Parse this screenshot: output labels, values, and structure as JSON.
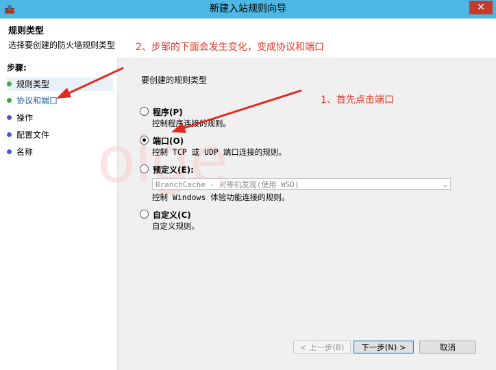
{
  "window": {
    "title": "新建入站规则向导",
    "close_label": "✕"
  },
  "header": {
    "title": "规则类型",
    "subtitle": "选择要创建的防火墙规则类型"
  },
  "annotations": {
    "top": "2、步邹的下面会发生变化，变成协议和端口",
    "right": "1、首先点击端口"
  },
  "sidebar": {
    "title": "步骤:",
    "steps": [
      {
        "label": "规则类型",
        "color": "#3fa842"
      },
      {
        "label": "协议和端口",
        "color": "#3fa842"
      },
      {
        "label": "操作",
        "color": "#4a5bc9"
      },
      {
        "label": "配置文件",
        "color": "#4a5bc9"
      },
      {
        "label": "名称",
        "color": "#4a5bc9"
      }
    ]
  },
  "main": {
    "question": "要创建的规则类型",
    "options": [
      {
        "label": "程序(P)",
        "desc": "控制程序连接的规则。",
        "selected": false
      },
      {
        "label": "端口(O)",
        "desc": "控制 TCP 或 UDP 端口连接的规则。",
        "selected": true
      },
      {
        "label": "预定义(E):",
        "desc": "控制 Windows 体验功能连接的规则。",
        "selected": false
      },
      {
        "label": "自定义(C)",
        "desc": "自定义规则。",
        "selected": false
      }
    ],
    "predefined_select": "BranchCache - 对等机发现(使用 WSD)"
  },
  "buttons": {
    "back": "< 上一步(B)",
    "next": "下一步(N) >",
    "cancel": "取消"
  },
  "watermark": "olge"
}
